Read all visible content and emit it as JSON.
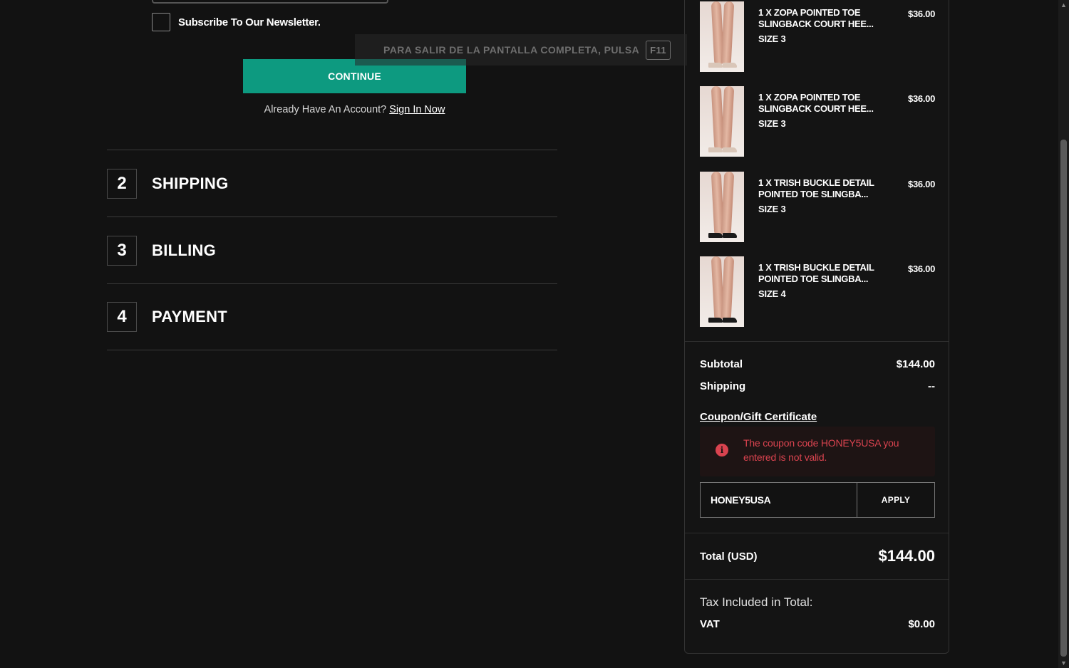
{
  "newsletter": {
    "label": "Subscribe To Our Newsletter."
  },
  "continue_label": "CONTINUE",
  "account": {
    "prompt": "Already Have An Account?",
    "link": "Sign In Now"
  },
  "steps": [
    {
      "num": "2",
      "title": "SHIPPING"
    },
    {
      "num": "3",
      "title": "BILLING"
    },
    {
      "num": "4",
      "title": "PAYMENT"
    }
  ],
  "fullscreen": {
    "text": "PARA SALIR DE LA PANTALLA COMPLETA, PULSA",
    "key": "F11"
  },
  "items": [
    {
      "name": "1 X ZOPA POINTED TOE SLINGBACK COURT HEE...",
      "size": "SIZE 3",
      "price": "$36.00",
      "shoe_color": "#d9c6b8"
    },
    {
      "name": "1 X ZOPA POINTED TOE SLINGBACK COURT HEE...",
      "size": "SIZE 3",
      "price": "$36.00",
      "shoe_color": "#d9c6b8"
    },
    {
      "name": "1 X TRISH BUCKLE DETAIL POINTED TOE SLINGBA...",
      "size": "SIZE 3",
      "price": "$36.00",
      "shoe_color": "#1a1a1a"
    },
    {
      "name": "1 X TRISH BUCKLE DETAIL POINTED TOE SLINGBA...",
      "size": "SIZE 4",
      "price": "$36.00",
      "shoe_color": "#1a1a1a"
    }
  ],
  "summary": {
    "subtotal_label": "Subtotal",
    "subtotal_value": "$144.00",
    "shipping_label": "Shipping",
    "shipping_value": "--",
    "coupon_link": "Coupon/Gift Certificate",
    "error_icon": "info-icon",
    "error_text": "The coupon code HONEY5USA you entered is not valid.",
    "coupon_value": "HONEY5USA",
    "apply_label": "APPLY",
    "total_label": "Total (USD)",
    "total_value": "$144.00",
    "tax_heading": "Tax Included in Total:",
    "vat_label": "VAT",
    "vat_value": "$0.00"
  },
  "colors": {
    "accent": "#0d9a80",
    "error": "#d9434f",
    "background": "#121212"
  }
}
